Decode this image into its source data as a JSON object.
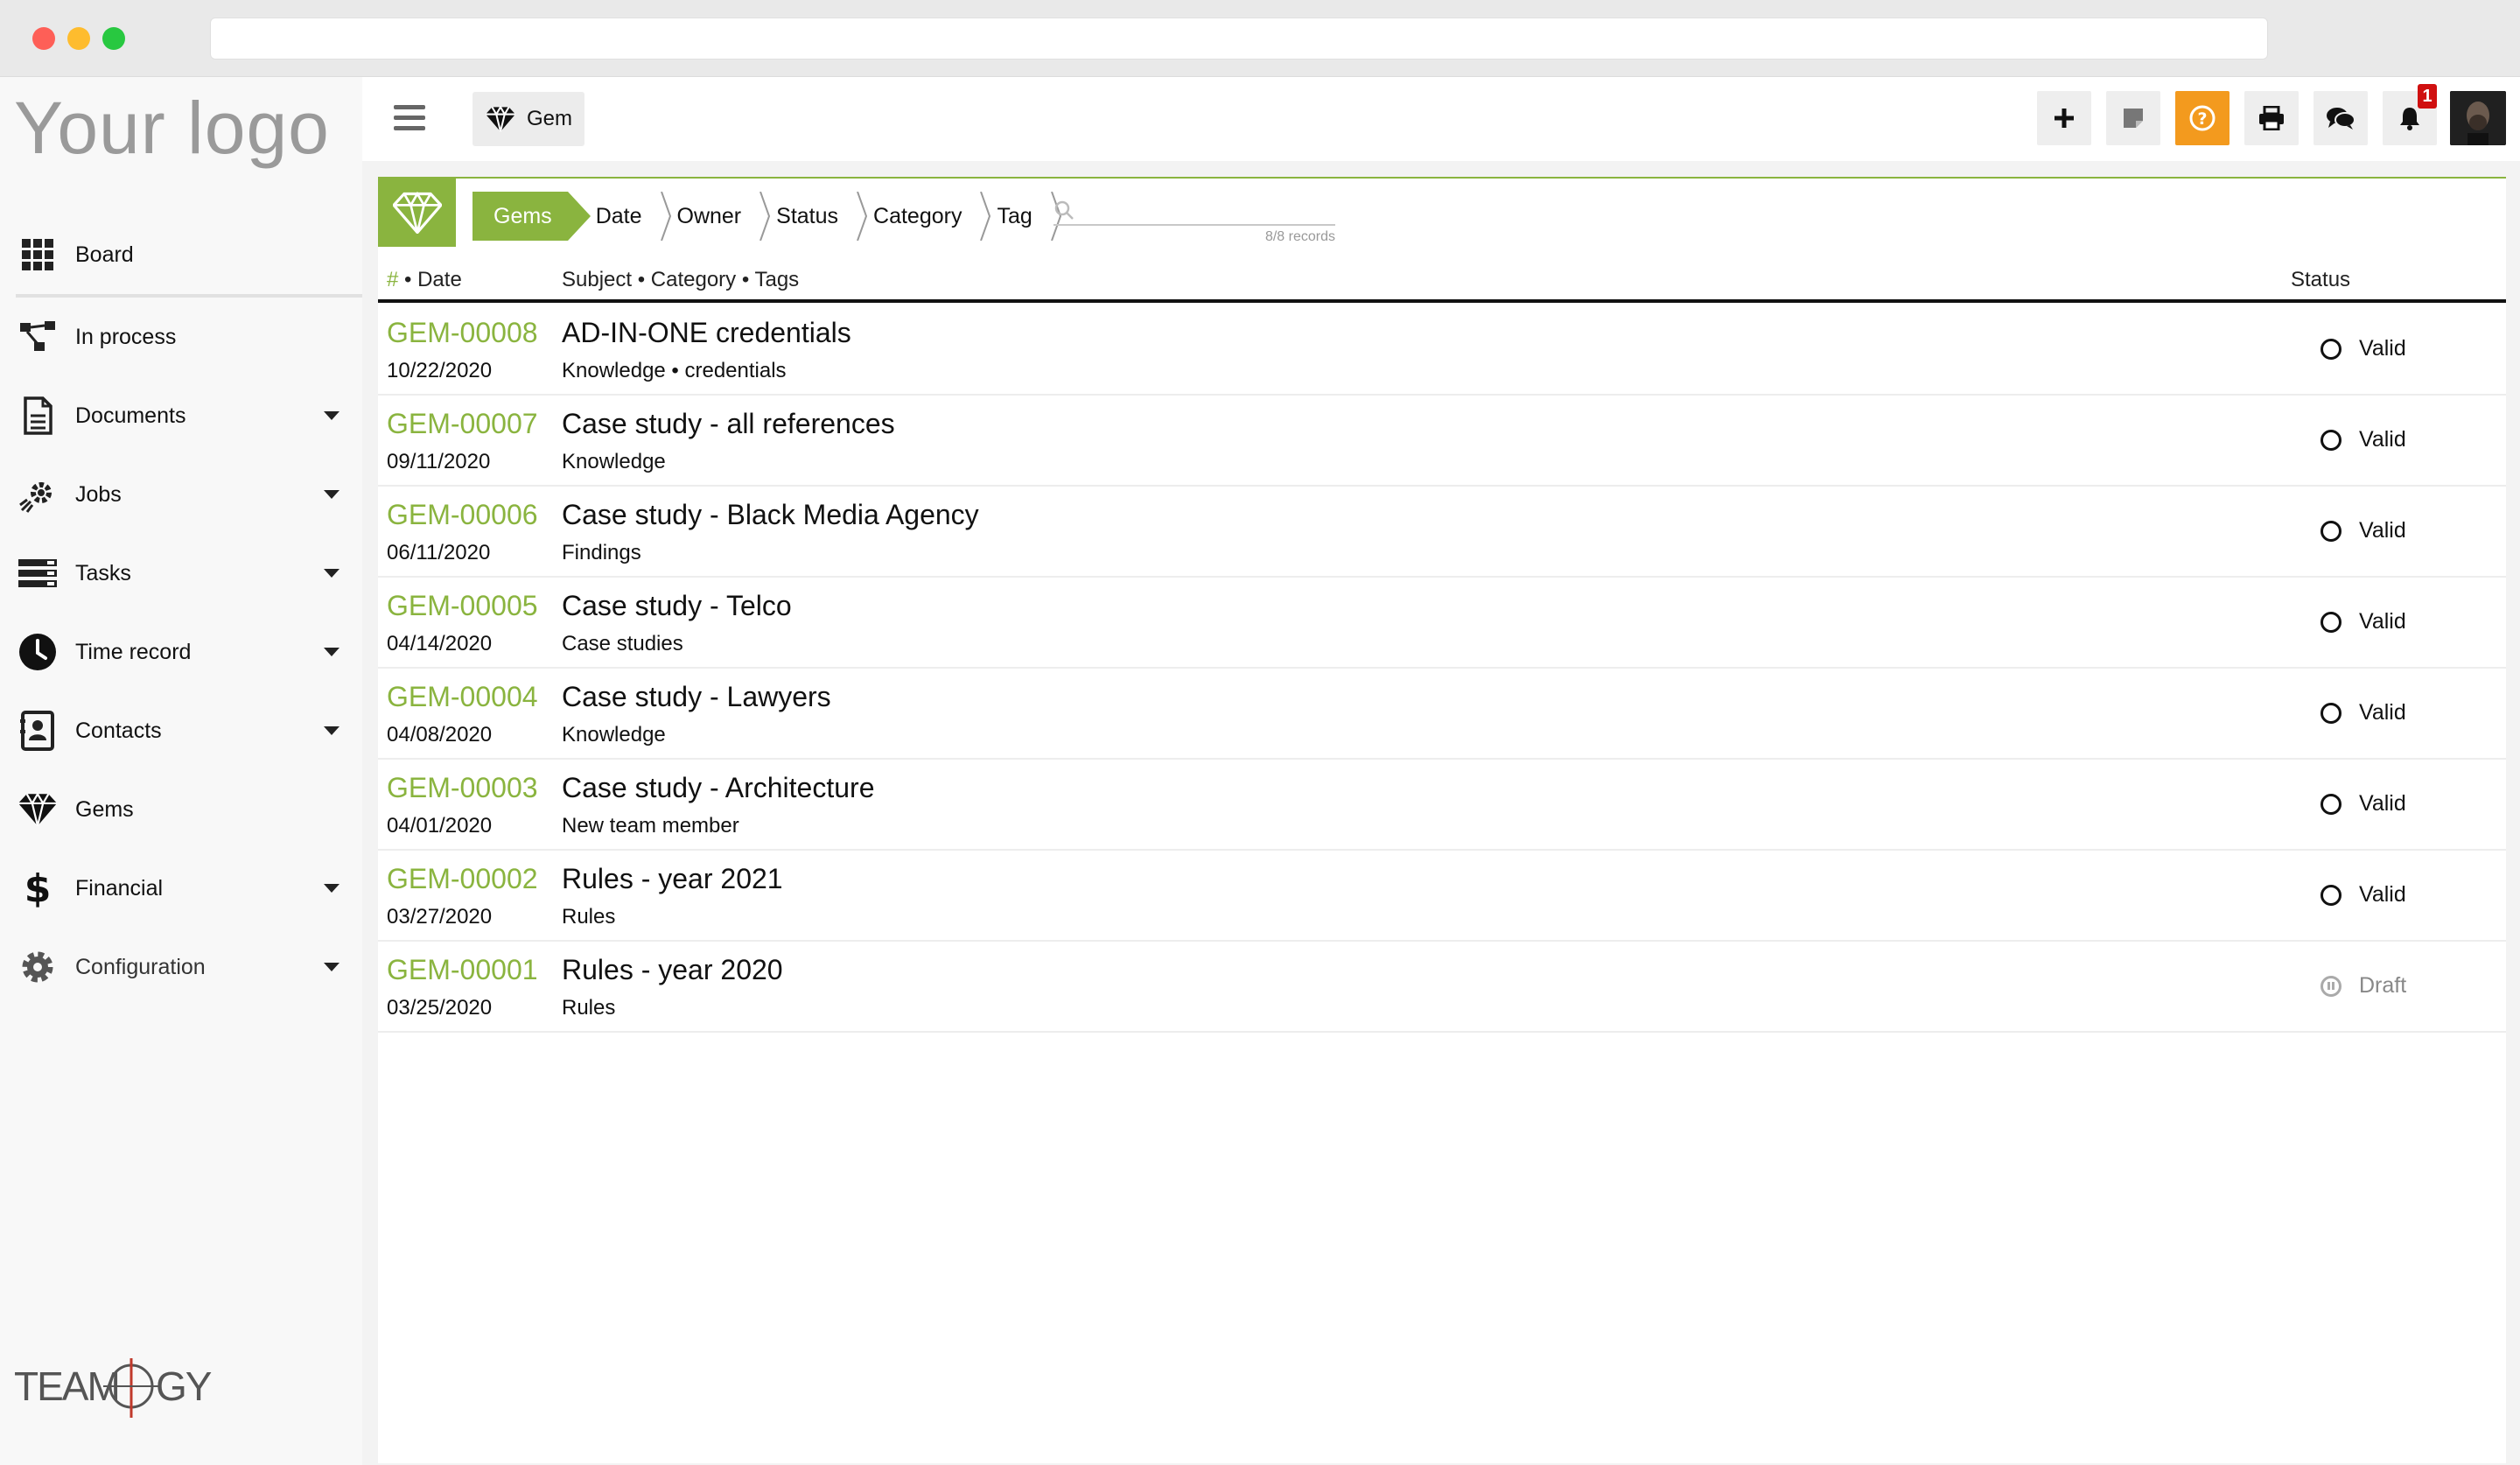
{
  "app": {
    "logo_text": "Your logo"
  },
  "sidebar": {
    "items": [
      {
        "label": "Board",
        "icon": "grid-icon",
        "caret": false
      },
      {
        "label": "In process",
        "icon": "workflow-icon",
        "caret": false
      },
      {
        "label": "Documents",
        "icon": "document-icon",
        "caret": true
      },
      {
        "label": "Jobs",
        "icon": "rocket-gear-icon",
        "caret": true
      },
      {
        "label": "Tasks",
        "icon": "tasks-icon",
        "caret": true
      },
      {
        "label": "Time record",
        "icon": "clock-icon",
        "caret": true
      },
      {
        "label": "Contacts",
        "icon": "contacts-icon",
        "caret": true
      },
      {
        "label": "Gems",
        "icon": "diamond-icon",
        "caret": false
      },
      {
        "label": "Financial",
        "icon": "dollar-icon",
        "caret": true
      },
      {
        "label": "Configuration",
        "icon": "gear-icon",
        "caret": true
      }
    ],
    "brand_mark": "TEAMOGY"
  },
  "topbar": {
    "module_label": "Gem",
    "notification_count": "1",
    "buttons": [
      "add-icon",
      "note-icon",
      "help-icon",
      "print-icon",
      "chat-icon",
      "bell-icon"
    ],
    "help_color": "#f39a1e"
  },
  "filters": {
    "crumbs": [
      "Gems",
      "Date",
      "Owner",
      "Status",
      "Category",
      "Tag"
    ],
    "records": "8/8 records"
  },
  "table": {
    "headers": {
      "hash": "#",
      "date": " • Date",
      "subject": "Subject • Category • Tags",
      "status": "Status"
    },
    "rows": [
      {
        "code": "GEM-00008",
        "date": "10/22/2020",
        "subject": "AD-IN-ONE credentials",
        "meta": "Knowledge • credentials",
        "status": "Valid"
      },
      {
        "code": "GEM-00007",
        "date": "09/11/2020",
        "subject": "Case study - all references",
        "meta": "Knowledge",
        "status": "Valid"
      },
      {
        "code": "GEM-00006",
        "date": "06/11/2020",
        "subject": "Case study - Black Media Agency",
        "meta": "Findings",
        "status": "Valid"
      },
      {
        "code": "GEM-00005",
        "date": "04/14/2020",
        "subject": "Case study - Telco",
        "meta": "Case studies",
        "status": "Valid"
      },
      {
        "code": "GEM-00004",
        "date": "04/08/2020",
        "subject": "Case study - Lawyers",
        "meta": "Knowledge",
        "status": "Valid"
      },
      {
        "code": "GEM-00003",
        "date": "04/01/2020",
        "subject": "Case study - Architecture",
        "meta": "New team member",
        "status": "Valid"
      },
      {
        "code": "GEM-00002",
        "date": "03/27/2020",
        "subject": "Rules - year 2021",
        "meta": "Rules",
        "status": "Valid"
      },
      {
        "code": "GEM-00001",
        "date": "03/25/2020",
        "subject": "Rules - year 2020",
        "meta": "Rules",
        "status": "Draft"
      }
    ]
  },
  "colors": {
    "accent": "#8ab43f",
    "badge": "#d01010"
  }
}
